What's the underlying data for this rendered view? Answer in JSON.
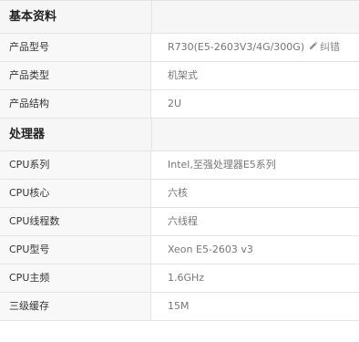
{
  "basic": {
    "title": "基本资料",
    "rows": [
      {
        "key": "产品型号",
        "value": "R730(E5-2603V3/4G/300G)"
      },
      {
        "key": "产品类型",
        "value": "机架式"
      },
      {
        "key": "产品结构",
        "value": "2U"
      }
    ],
    "edit_label": "纠错"
  },
  "cpu": {
    "title": "处理器",
    "rows": [
      {
        "key": "CPU系列",
        "value": "Intel,至强处理器E5系列"
      },
      {
        "key": "CPU核心",
        "value": "六核"
      },
      {
        "key": "CPU线程数",
        "value": "六线程"
      },
      {
        "key": "CPU型号",
        "value": "Xeon E5-2603 v3"
      },
      {
        "key": "CPU主频",
        "value": "1.6GHz"
      },
      {
        "key": "三级缓存",
        "value": "15M"
      }
    ]
  },
  "icons": {
    "edit": "pencil-icon"
  }
}
